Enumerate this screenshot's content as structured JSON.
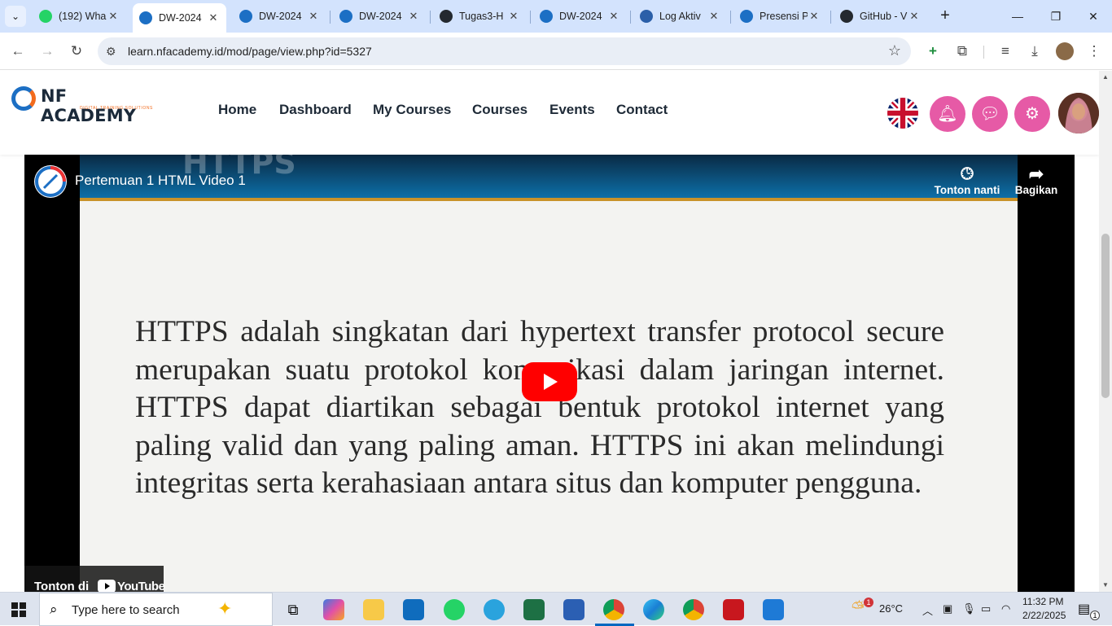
{
  "browser": {
    "tabs": [
      {
        "title": "(192) Wha",
        "favicon_icon": "whatsapp-icon",
        "color": "#25d366",
        "active": false
      },
      {
        "title": "DW-2024",
        "favicon_icon": "nf-academy-icon",
        "color": "#1c6fc4",
        "active": true
      },
      {
        "title": "DW-2024",
        "favicon_icon": "nf-academy-icon",
        "color": "#1c6fc4",
        "active": false
      },
      {
        "title": "DW-2024",
        "favicon_icon": "nf-academy-icon",
        "color": "#1c6fc4",
        "active": false
      },
      {
        "title": "Tugas3-H",
        "favicon_icon": "github-icon",
        "color": "#24292f",
        "active": false
      },
      {
        "title": "DW-2024",
        "favicon_icon": "nf-academy-icon",
        "color": "#1c6fc4",
        "active": false
      },
      {
        "title": "Log Aktiv",
        "favicon_icon": "globe-icon",
        "color": "#2b5fa8",
        "active": false
      },
      {
        "title": "Presensi P",
        "favicon_icon": "nf-academy-icon",
        "color": "#1c6fc4",
        "active": false
      },
      {
        "title": "GitHub - V",
        "favicon_icon": "github-icon",
        "color": "#24292f",
        "active": false
      }
    ],
    "url": "learn.nfacademy.id/mod/page/view.php?id=5327"
  },
  "site": {
    "logo_name": "NF ACADEMY",
    "logo_tagline": "DIGITAL TRAINING SOLUTIONS",
    "nav": [
      "Home",
      "Dashboard",
      "My Courses",
      "Courses",
      "Events",
      "Contact"
    ]
  },
  "video": {
    "title": "Pertemuan 1 HTML Video 1",
    "ghost_heading": "HTTPS",
    "slide_text": "HTTPS adalah singkatan dari hypertext transfer protocol secure merupakan suatu protokol komunikasi dalam jaringan internet. HTTPS dapat diartikan sebagai bentuk protokol internet yang paling valid dan yang paling aman. HTTPS ini akan melindungi integritas serta kerahasiaan antara situs dan komputer pengguna.",
    "watch_later": "Tonton nanti",
    "share": "Bagikan",
    "watch_on": "Tonton di",
    "youtube": "YouTube"
  },
  "taskbar": {
    "search_placeholder": "Type here to search",
    "weather": "26°C",
    "weather_badge": "1",
    "time": "11:32 PM",
    "date": "2/22/2025",
    "notification_count": "1"
  }
}
